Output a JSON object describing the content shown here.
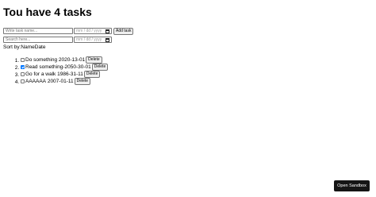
{
  "header": {
    "title": "Tou have 4 tasks"
  },
  "add_form": {
    "task_placeholder": "Write task name...",
    "date_placeholder": "mm / dd / yyyy",
    "add_label": "Add task"
  },
  "search_form": {
    "search_placeholder": "Search here...",
    "date_placeholder": "mm / dd / yyyy"
  },
  "sort": {
    "label": "Sort by:",
    "options": [
      "Name",
      "Date"
    ]
  },
  "tasks": [
    {
      "name": "Do something",
      "date": "2020-13-01",
      "checked": false,
      "delete_label": "Delete"
    },
    {
      "name": "Read something",
      "date": "2050-30-01",
      "checked": true,
      "delete_label": "Delete"
    },
    {
      "name": "Go for a walk",
      "date": "1986-31-11",
      "checked": false,
      "delete_label": "Delete"
    },
    {
      "name": "AAAAAA",
      "date": "2007-01-11",
      "checked": false,
      "delete_label": "Delete"
    }
  ],
  "sandbox_button": {
    "label": "Open Sandbox"
  },
  "icons": {
    "calendar": "calendar-icon",
    "checkbox": "checkbox-icon"
  }
}
